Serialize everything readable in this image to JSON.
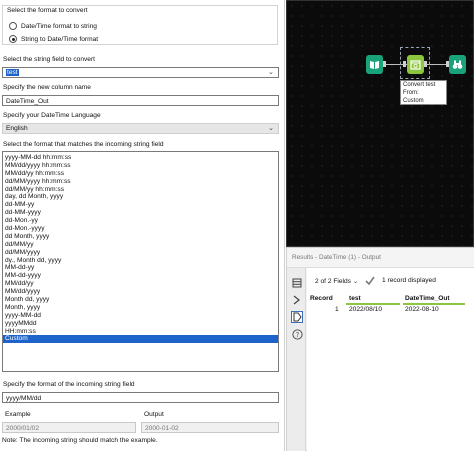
{
  "config": {
    "convert_section": {
      "legend": "Select the format to convert",
      "options": [
        {
          "label": "Date/Time format to string",
          "checked": false
        },
        {
          "label": "String to Date/Time format",
          "checked": true
        }
      ]
    },
    "string_field": {
      "label": "Select the string field to convert",
      "value": "test"
    },
    "new_column": {
      "label": "Specify the new column name",
      "value": "DateTime_Out"
    },
    "language": {
      "label": "Specify your DateTime Language",
      "value": "English"
    },
    "format_list": {
      "label": "Select the format that matches the incoming string field",
      "items": [
        "yyyy-MM-dd hh:mm:ss",
        "MM/dd/yyyy hh:mm:ss",
        "MM/dd/yy hh:mm:ss",
        "dd/MM/yyyy hh:mm:ss",
        "dd/MM/yy hh:mm:ss",
        "day, dd Month, yyyy",
        "dd-MM-yy",
        "dd-MM-yyyy",
        "dd-Mon.-yy",
        "dd-Mon.-yyyy",
        "dd Month, yyyy",
        "dd/MM/yy",
        "dd/MM/yyyy",
        "dy., Month dd, yyyy",
        "MM-dd-yy",
        "MM-dd-yyyy",
        "MM/dd/yy",
        "MM/dd/yyyy",
        "Month dd, yyyy",
        "Month, yyyy",
        "yyyy-MM-dd",
        "yyyyMMdd",
        "HH:mm:ss",
        "Custom"
      ],
      "selected": "Custom"
    },
    "custom_format": {
      "label": "Specify the format of the incoming string field",
      "value": "yyyy/MM/dd"
    },
    "example": {
      "label": "Example",
      "value": "2000/01/02"
    },
    "output": {
      "label": "Output",
      "value": "2000-01-02"
    },
    "note": "Note: The incoming string should match the example."
  },
  "canvas": {
    "annotation": [
      "Convert test",
      "From:",
      "Custom"
    ],
    "colors": {
      "input_tool": "#19a37a",
      "datetime_tool": "#8cc63f",
      "browse_tool": "#19a37a"
    }
  },
  "results": {
    "title": "Results - DateTime (1) - Output",
    "fields_label": "2 of 2 Fields",
    "records_label": "1 record displayed",
    "columns": [
      "Record",
      "test",
      "DateTime_Out"
    ],
    "rows": [
      [
        "1",
        "2022/08/10",
        "2022-08-10"
      ]
    ],
    "colors": {
      "header_underline": "#8cc63f",
      "check": "#7a7a7a"
    }
  }
}
